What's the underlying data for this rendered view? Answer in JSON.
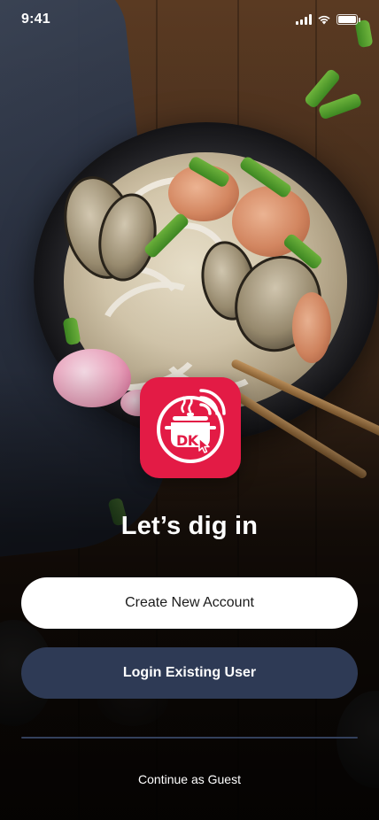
{
  "status_bar": {
    "time": "9:41"
  },
  "logo": {
    "icon": "smart-cooking-pot-icon",
    "text": "DK",
    "color": "#e31b45"
  },
  "welcome": {
    "headline": "Let’s dig in"
  },
  "actions": {
    "create_account_label": "Create New Account",
    "login_label": "Login Existing User",
    "guest_label": "Continue as Guest"
  },
  "colors": {
    "accent": "#e31b45",
    "login_button": "#2e3a55",
    "create_button": "#ffffff"
  }
}
